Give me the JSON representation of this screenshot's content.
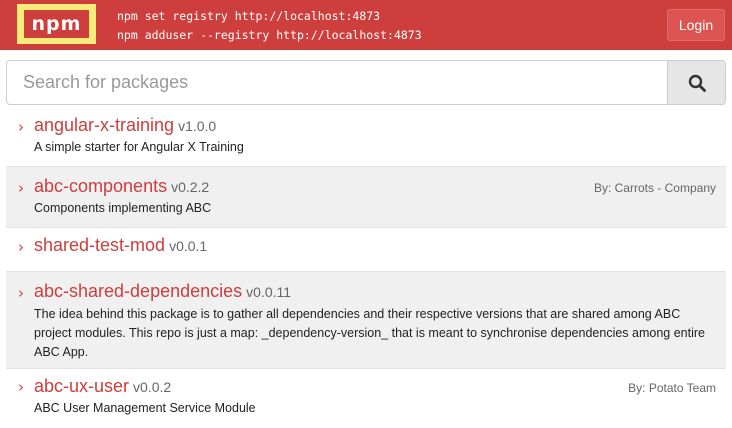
{
  "header": {
    "logo_text": "npm",
    "commands": [
      "npm set registry http://localhost:4873",
      "npm adduser --registry http://localhost:4873"
    ],
    "login_label": "Login"
  },
  "search": {
    "placeholder": "Search for packages",
    "value": ""
  },
  "packages": [
    {
      "name": "angular-x-training",
      "version": "v1.0.0",
      "author": "",
      "description": "A simple starter for Angular X Training"
    },
    {
      "name": "abc-components",
      "version": "v0.2.2",
      "author": "By: Carrots - Company",
      "description": "Components implementing ABC"
    },
    {
      "name": "shared-test-mod",
      "version": "v0.0.1",
      "author": "",
      "description": ""
    },
    {
      "name": "abc-shared-dependencies",
      "version": "v0.0.11",
      "author": "",
      "description": "The idea behind this package is to gather all dependencies and their respective versions that are shared among ABC project modules. This repo is just a map: _dependency-version_ that is meant to synchronise dependencies among entire ABC App."
    },
    {
      "name": "abc-ux-user",
      "version": "v0.0.2",
      "author": "By: Potato Team",
      "description": "ABC User Management Service Module"
    }
  ]
}
